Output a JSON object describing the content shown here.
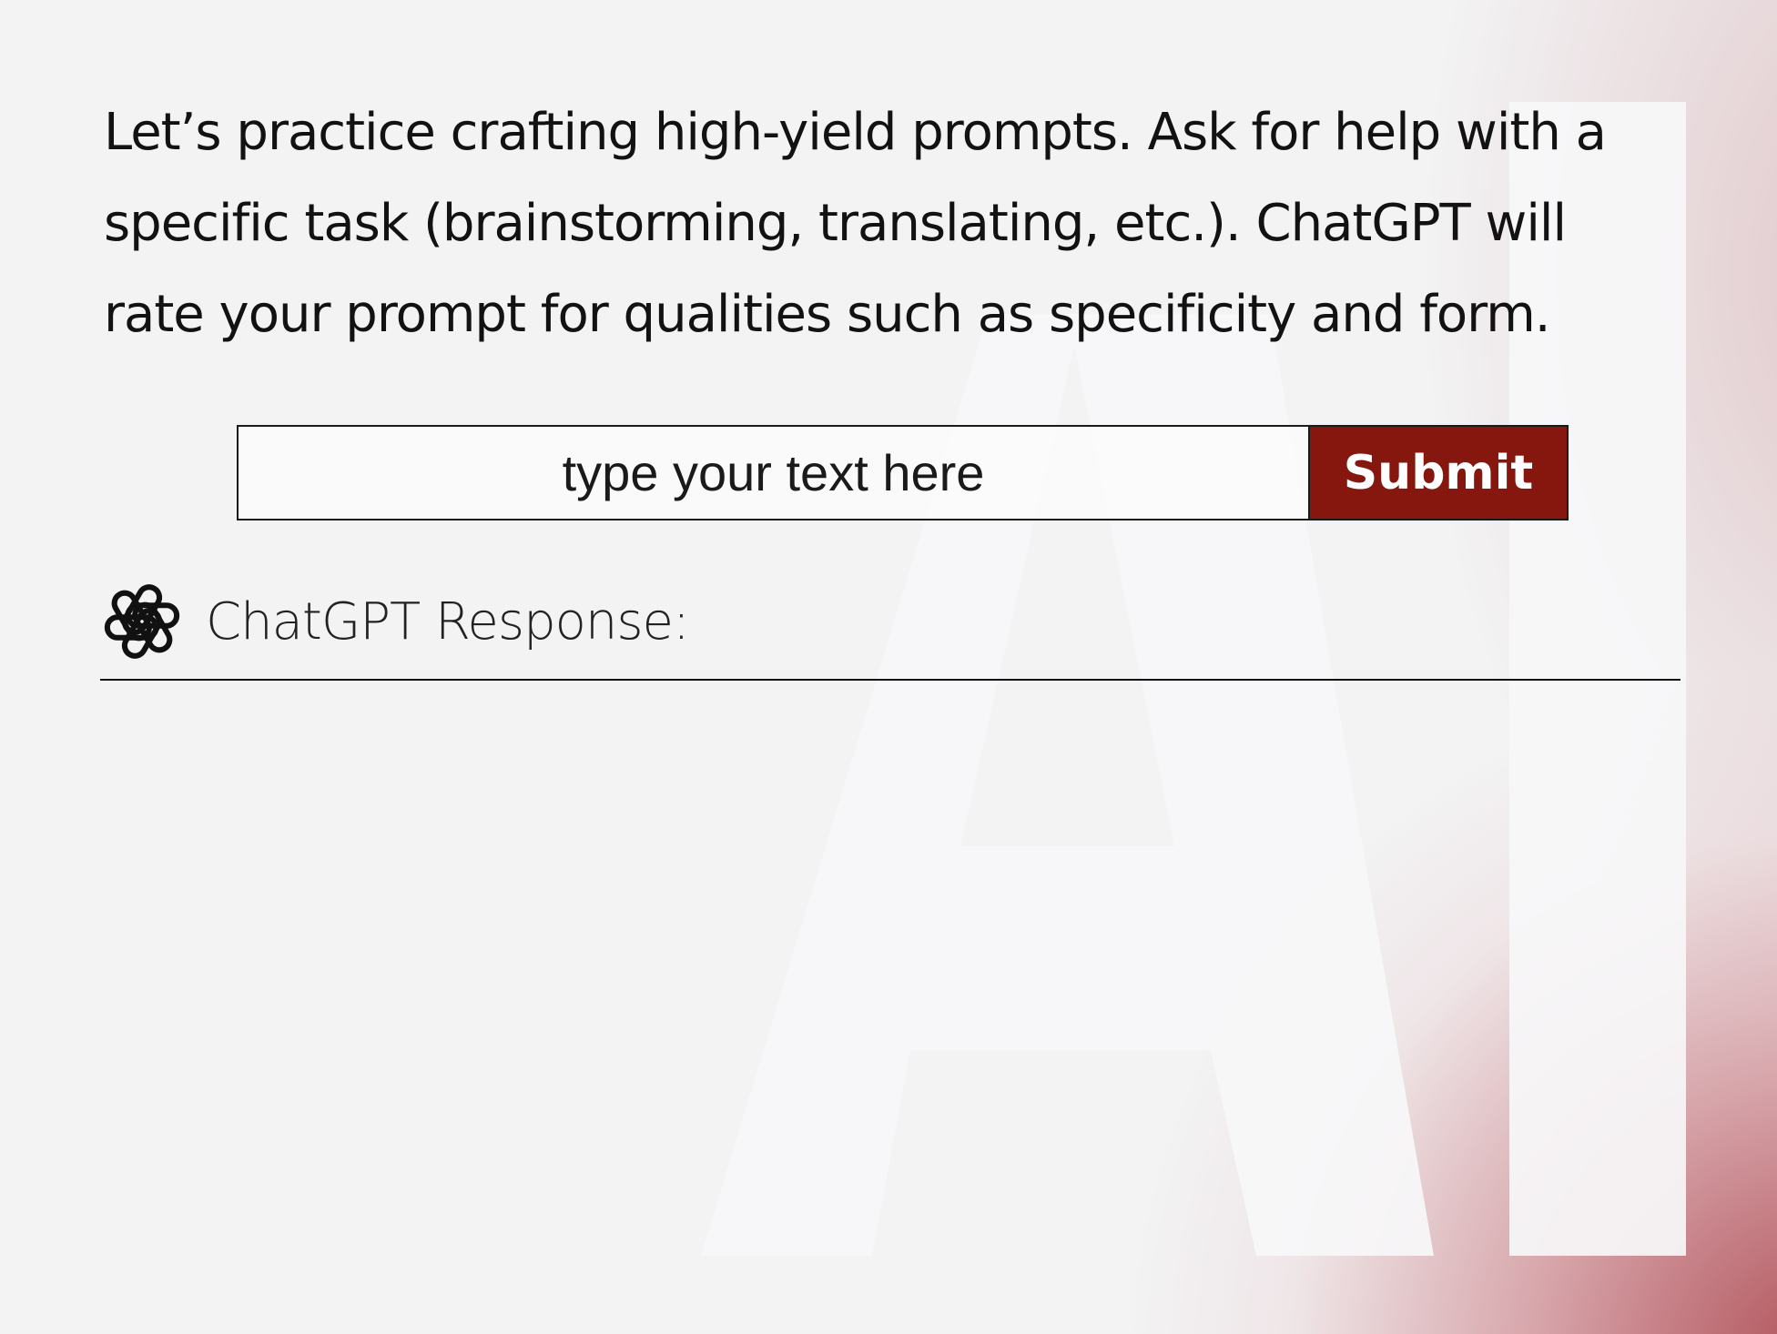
{
  "intro": {
    "text": "Let’s practice crafting high-yield prompts. Ask for help with a specific task (brainstorming, translating, etc.). ChatGPT will rate your prompt for qualities such as specificity and form."
  },
  "prompt_input": {
    "placeholder": "type your text here",
    "value": ""
  },
  "submit": {
    "label": "Submit"
  },
  "response": {
    "label": "ChatGPT Response:",
    "logo_icon": "openai-logo-icon",
    "body": ""
  },
  "background": {
    "watermark_text": "AI",
    "accent_color": "#85170f"
  }
}
